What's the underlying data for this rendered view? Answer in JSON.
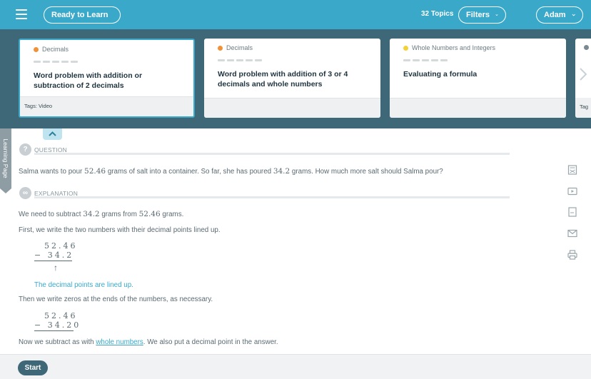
{
  "header": {
    "menu_icon": "hamburger-icon",
    "learn_dropdown": "Ready to Learn",
    "topics_count": "32 Topics",
    "filters_label": "Filters",
    "user_label": "Adam"
  },
  "cards": [
    {
      "category": "Decimals",
      "dot_color": "#f0923a",
      "title": "Word problem with addition or subtraction of 2 decimals",
      "tags": "Tags: Video"
    },
    {
      "category": "Decimals",
      "dot_color": "#f0923a",
      "title": "Word problem with addition of 3 or 4 decimals and whole numbers",
      "tags": ""
    },
    {
      "category": "Whole Numbers and Integers",
      "dot_color": "#f2d23a",
      "title": "Evaluating a formula",
      "tags": ""
    }
  ],
  "card_partial": {
    "tags": "Tag"
  },
  "side_tab": {
    "label": "Learning Page"
  },
  "question": {
    "heading": "QUESTION",
    "icon_text": "?",
    "text_a": "Salma wants to pour ",
    "num_a": "52.46",
    "text_b": " grams of salt into a container. So far, she has poured ",
    "num_b": "34.2",
    "text_c": " grams. How much more salt should Salma pour?"
  },
  "explanation": {
    "heading": "EXPLANATION",
    "icon_text": "∞",
    "line1_a": "We need to subtract ",
    "line1_num_a": "34.2",
    "line1_b": " grams from ",
    "line1_num_b": "52.46",
    "line1_c": " grams.",
    "line2": "First, we write the two numbers with their decimal points lined up.",
    "math1_top": "52.46",
    "math1_bottom": "− 34.2",
    "note": "The decimal points are lined up.",
    "line3": "Then we write zeros at the ends of the numbers, as necessary.",
    "math2_top": "52.46",
    "math2_bottom": "− 34.20",
    "line4_a": "Now we subtract as with ",
    "line4_link": "whole numbers",
    "line4_b": ". We also put a decimal point in the answer."
  },
  "footer": {
    "start_label": "Start"
  },
  "colors": {
    "topbar": "#3aa8c9",
    "cards_bg": "#3e6878",
    "accent": "#3aa8c9"
  }
}
